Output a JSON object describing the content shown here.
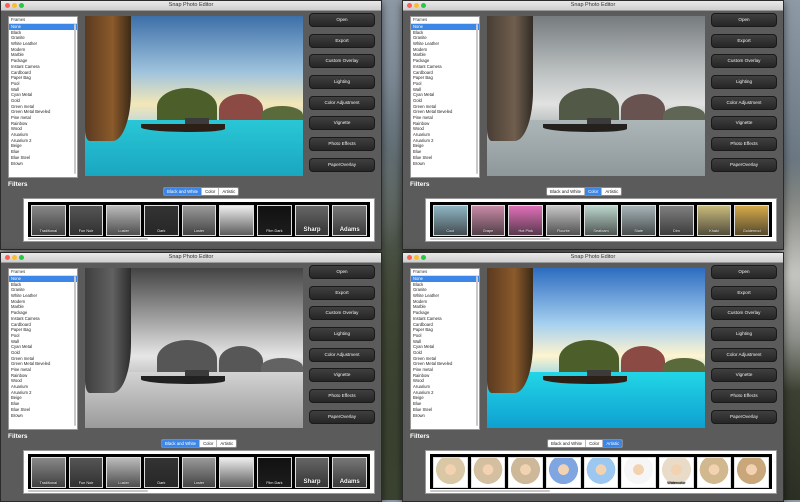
{
  "app_title": "Snap Photo Editor",
  "frames": {
    "header": "Frames",
    "items": [
      "None",
      "Black",
      "Granite",
      "White Leather",
      "Modern",
      "Marble",
      "Package",
      "Instant Camera",
      "Cardboard",
      "Paper Bag",
      "Pool",
      "Wall",
      "Cyan Metal",
      "Gold",
      "Green metal",
      "Green Metal Beveled",
      "Pine metal",
      "Rainbow",
      "Wood",
      "Aruarium",
      "Aruarium 2",
      "Beige",
      "Blue",
      "Blue Steel",
      "Brown"
    ],
    "selected_index": 0
  },
  "buttons": [
    "Open",
    "Export",
    "Custom Overlay",
    "Lighting",
    "Color Adjustment",
    "Vignette",
    "Photo Effects",
    "PaperOverlay"
  ],
  "filters_label": "Filters",
  "filter_tabs": [
    "Black and White",
    "Color",
    "Artistic"
  ],
  "windows": [
    {
      "active_tab": 0,
      "photo_style": "color-vivid",
      "thumb_labels": [
        "Traditional",
        "Fun Noir",
        "Luster",
        "Dark",
        "Luster",
        "",
        "Film Dark",
        "Sharp",
        "Adams"
      ],
      "thumb_style": "bw"
    },
    {
      "active_tab": 1,
      "photo_style": "desaturated",
      "thumb_labels": [
        "Cool",
        "Grape",
        "Hot Pink",
        "Flourite",
        "Seafoam",
        "Slate",
        "Dim",
        "Khaki",
        "Goldenrod"
      ],
      "thumb_style": "color"
    },
    {
      "active_tab": 0,
      "photo_style": "grayscale",
      "thumb_labels": [
        "Traditional",
        "Fun Noir",
        "Luster",
        "Dark",
        "Luster",
        "",
        "Film Dark",
        "Sharp",
        "Adams"
      ],
      "thumb_style": "bw"
    },
    {
      "active_tab": 2,
      "photo_style": "artistic",
      "thumb_labels": [
        "",
        "",
        "",
        "",
        "",
        "",
        "Watercolor",
        "",
        ""
      ],
      "thumb_style": "portrait"
    }
  ],
  "colors": {
    "accent": "#3b86e6",
    "window_bg": "#5b5b5b",
    "button_bg": "#2f2f2f"
  }
}
